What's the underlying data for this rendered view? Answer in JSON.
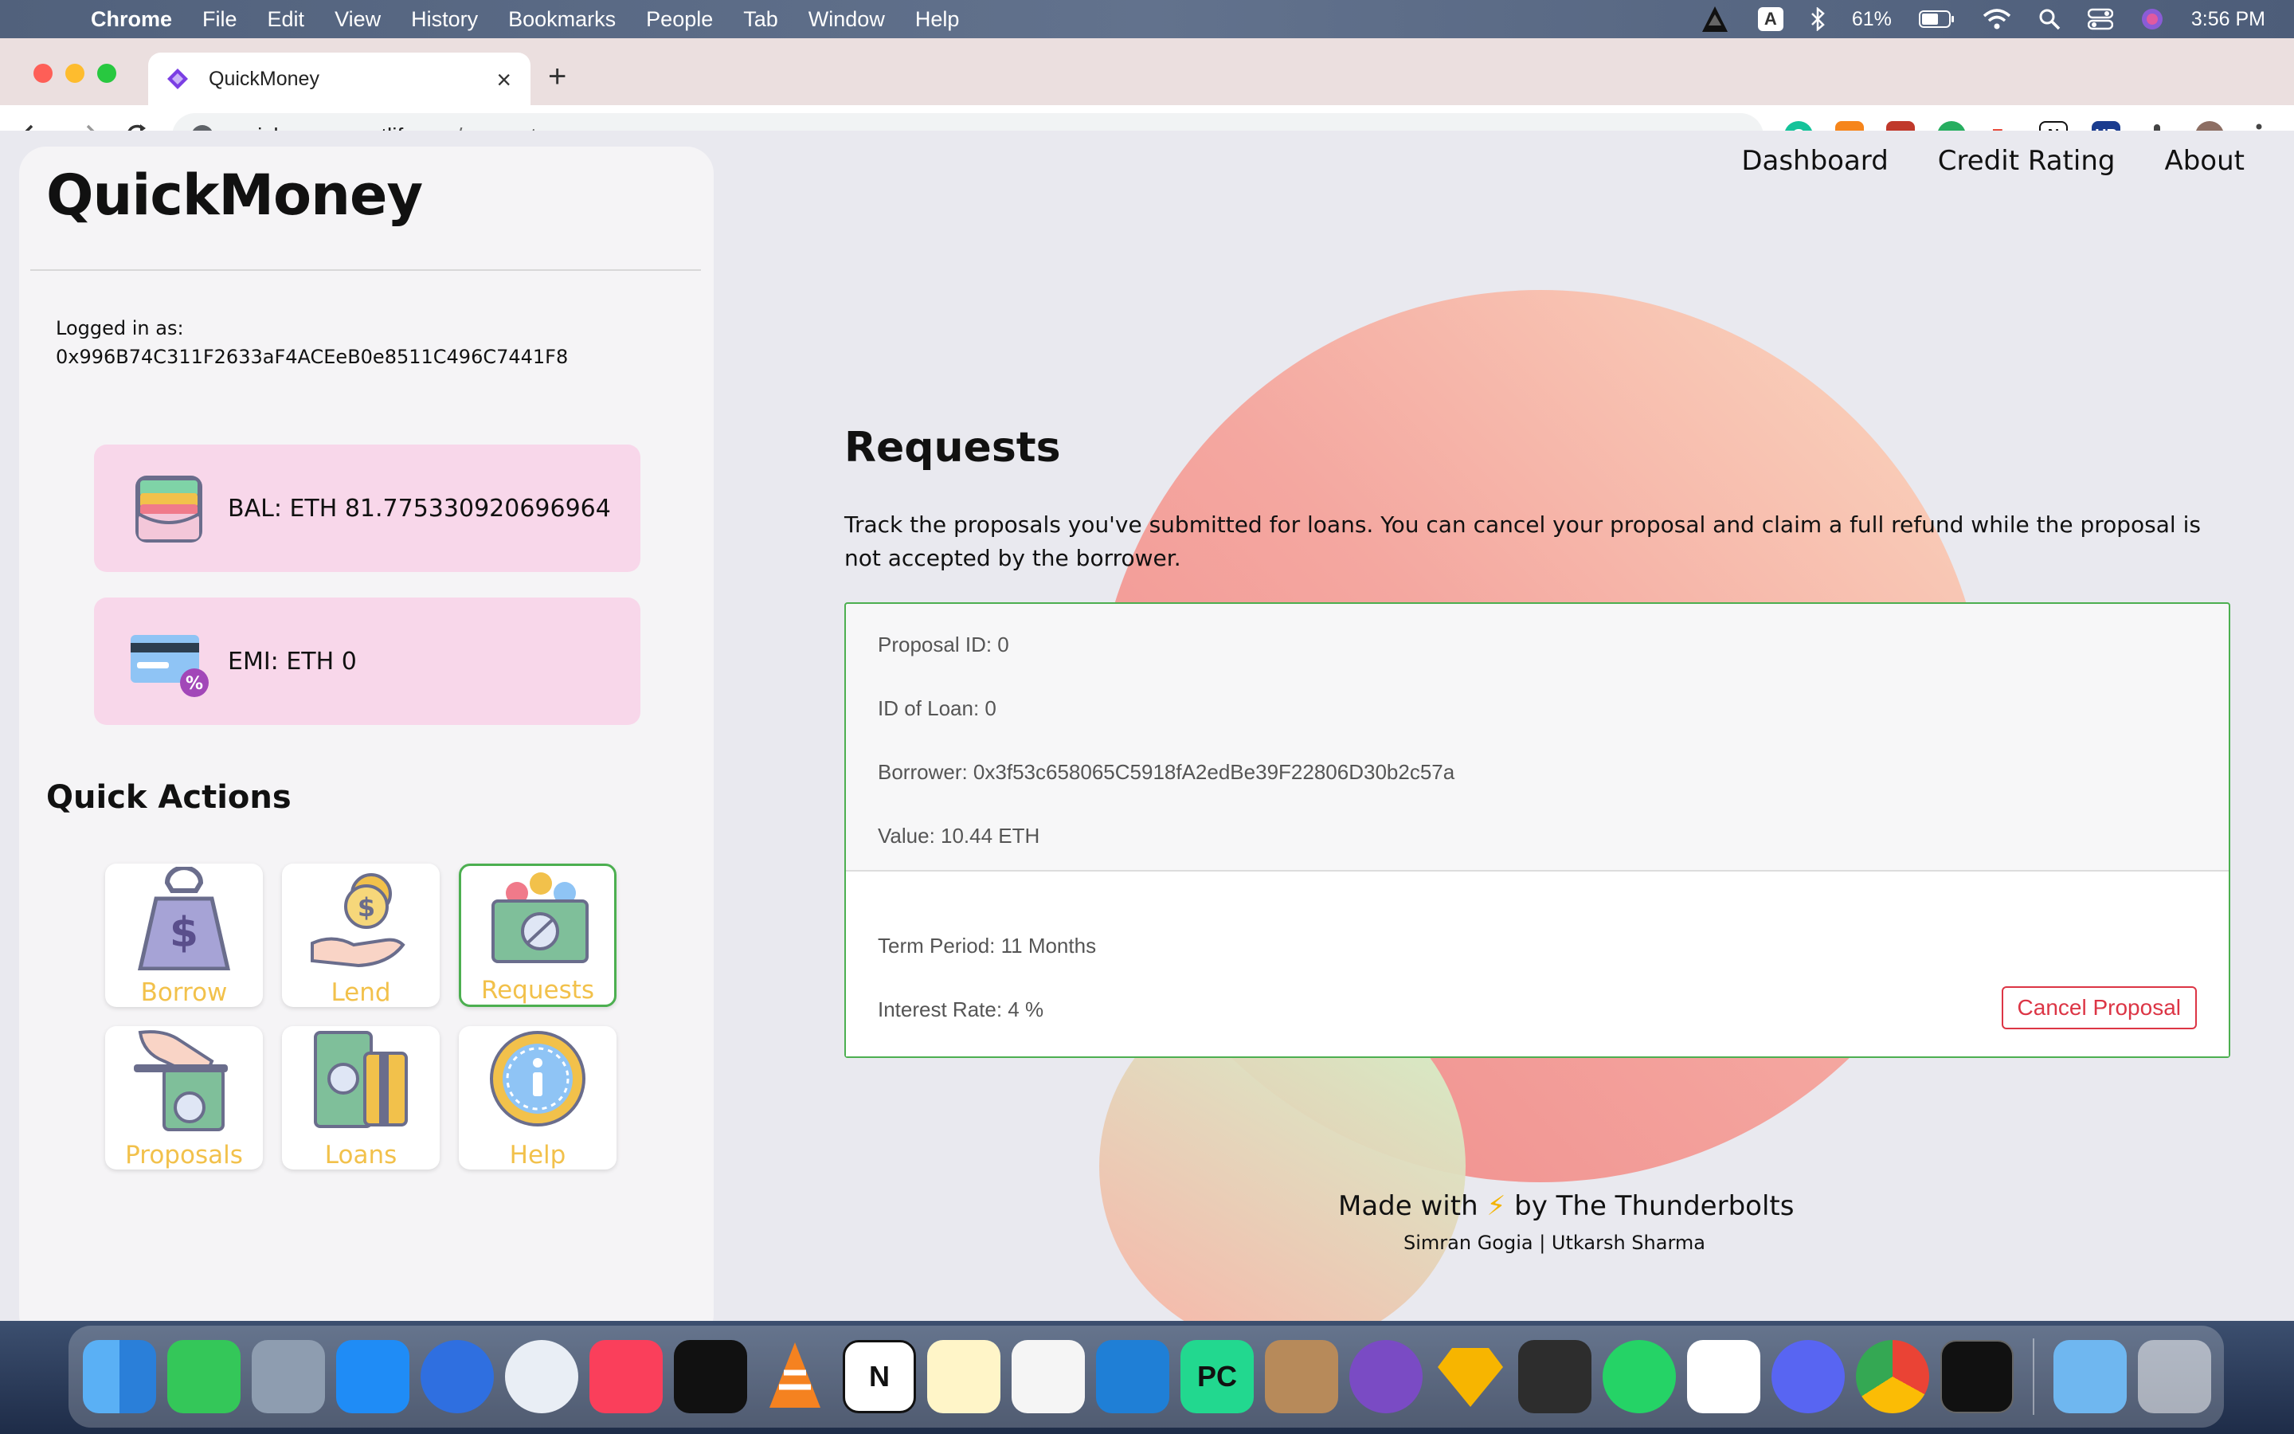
{
  "menubar": {
    "app": "Chrome",
    "items": [
      "File",
      "Edit",
      "View",
      "History",
      "Bookmarks",
      "People",
      "Tab",
      "Window",
      "Help"
    ],
    "input_source": "A",
    "battery": "61%",
    "time": "3:56 PM"
  },
  "browser": {
    "tab_title": "QuickMoney",
    "url_host": "quickmoney.netlify.app",
    "url_path": "/requests",
    "extensions": [
      "grammarly-icon",
      "metamask-icon",
      "ext-red-icon",
      "ext-green-icon",
      "tp-icon",
      "notion-icon",
      "hp-icon",
      "puzzle-icon",
      "profile-icon"
    ]
  },
  "sidebar": {
    "brand": "QuickMoney",
    "logged_in_label": "Logged in as:",
    "address": "0x996B74C311F2633aF4ACEeB0e8511C496C7441F8",
    "balance": "BAL: ETH 81.775330920696964",
    "emi": "EMI: ETH 0",
    "quick_actions_title": "Quick Actions",
    "actions": [
      "Borrow",
      "Lend",
      "Requests",
      "Proposals",
      "Loans",
      "Help"
    ]
  },
  "nav": [
    "Dashboard",
    "Credit Rating",
    "About"
  ],
  "main": {
    "title": "Requests",
    "description": "Track the proposals you've submitted for loans. You can cancel your proposal and claim a full refund while the proposal is not accepted by the borrower.",
    "proposal": {
      "proposal_id": "Proposal ID: 0",
      "loan_id": "ID of Loan: 0",
      "borrower": "Borrower: 0x3f53c658065C5918fA2edBe39F22806D30b2c57a",
      "value": "Value: 10.44 ETH",
      "term": "Term Period: 11 Months",
      "interest": "Interest Rate: 4 %",
      "cancel_label": "Cancel Proposal"
    }
  },
  "footer": {
    "made_with": "Made with",
    "bolt": "⚡",
    "by": "by The Thunderbolts",
    "authors": "Simran Gogia | Utkarsh Sharma"
  },
  "dock": [
    "finder",
    "messages",
    "launchpad",
    "app-store",
    "spark",
    "safari",
    "music",
    "tv",
    "vlc",
    "notion",
    "notes",
    "script-editor",
    "vscode",
    "pycharm",
    "box",
    "github",
    "sketch",
    "final-cut",
    "whatsapp",
    "slack",
    "discord",
    "chrome",
    "terminal",
    "downloads",
    "trash"
  ],
  "colors": {
    "accent_green": "#4caf50",
    "danger": "#dc3545",
    "card_pink": "#f8d7ea",
    "tile_label": "#f2c14b"
  }
}
